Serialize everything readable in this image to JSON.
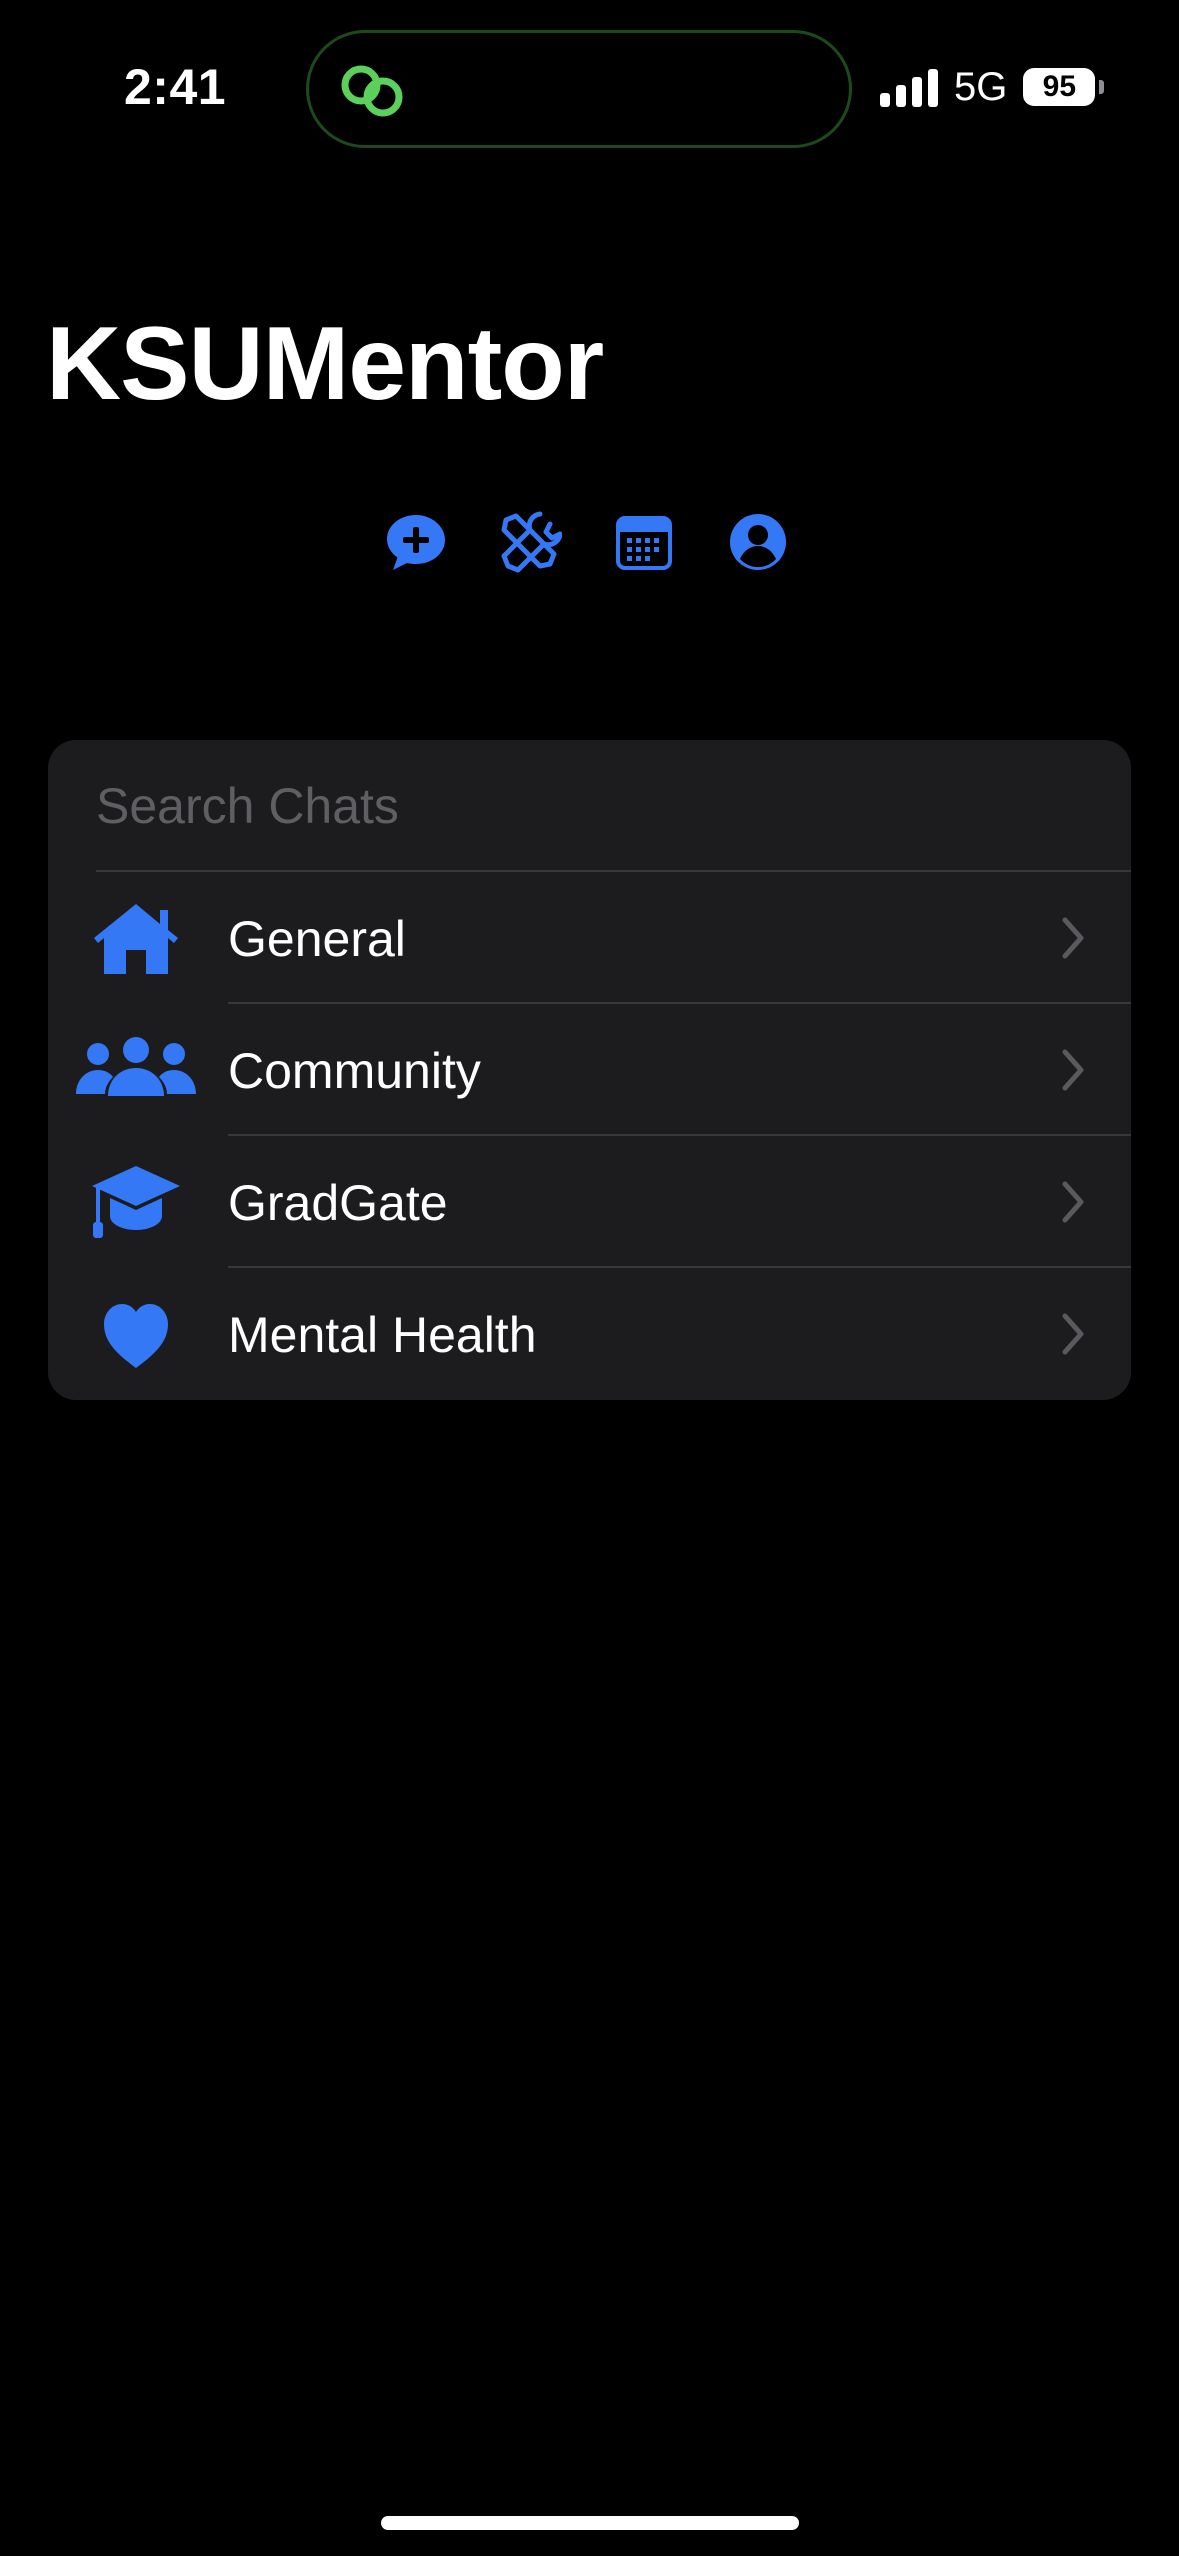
{
  "status_bar": {
    "time": "2:41",
    "network": "5G",
    "battery": "95",
    "island_icon": "link-rings-icon"
  },
  "app": {
    "title": "KSUMentor",
    "accent_color": "#3478f6"
  },
  "toolbar": [
    {
      "icon": "new-chat-icon"
    },
    {
      "icon": "tools-icon"
    },
    {
      "icon": "calendar-icon"
    },
    {
      "icon": "profile-icon"
    }
  ],
  "search": {
    "placeholder": "Search Chats",
    "value": ""
  },
  "chats": [
    {
      "label": "General",
      "icon": "house-icon"
    },
    {
      "label": "Community",
      "icon": "people-icon"
    },
    {
      "label": "GradGate",
      "icon": "graduation-cap-icon"
    },
    {
      "label": "Mental Health",
      "icon": "heart-icon"
    }
  ]
}
